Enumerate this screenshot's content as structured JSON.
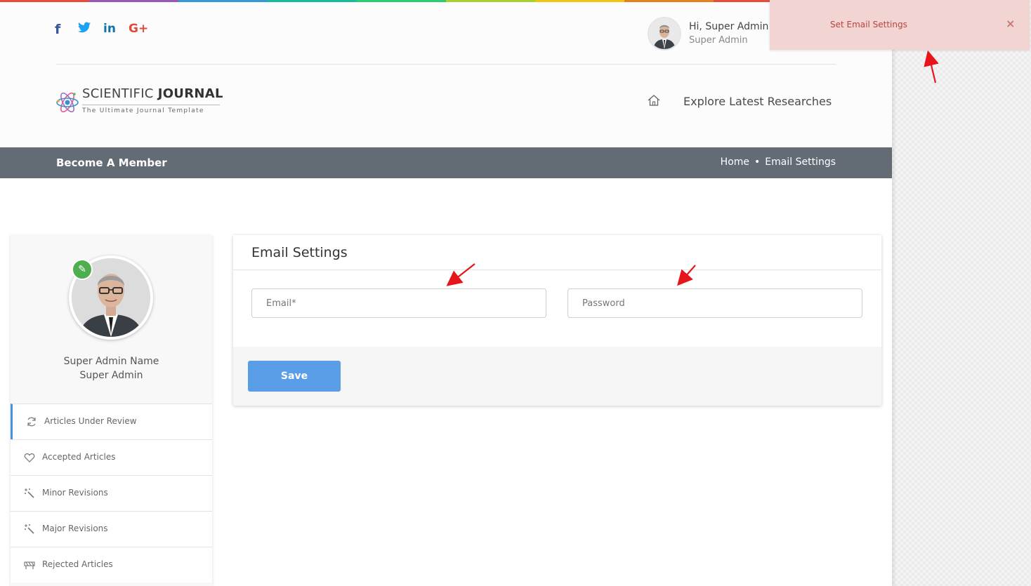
{
  "social": {
    "facebook": "f",
    "twitter": "🐦",
    "linkedin": "in",
    "googleplus": "G+"
  },
  "user": {
    "greeting": "Hi, Super Admin N",
    "role": "Super Admin"
  },
  "logo": {
    "title_light": "SCIENTIFIC ",
    "title_bold": "JOURNAL",
    "tagline": "The Ultimate Journal Template"
  },
  "nav": {
    "explore": "Explore Latest Researches"
  },
  "band": {
    "title": "Become A Member",
    "crumb_home": "Home",
    "crumb_separator": "•",
    "crumb_current": "Email Settings"
  },
  "profile": {
    "name": "Super Admin Name",
    "role": "Super Admin",
    "edit_icon": "pencil-icon"
  },
  "menu": [
    {
      "label": "Articles Under Review",
      "icon": "refresh-icon"
    },
    {
      "label": "Accepted Articles",
      "icon": "heart-icon"
    },
    {
      "label": "Minor Revisions",
      "icon": "magic-wand-icon"
    },
    {
      "label": "Major Revisions",
      "icon": "magic-wand-icon"
    },
    {
      "label": "Rejected Articles",
      "icon": "barrier-icon"
    }
  ],
  "settings": {
    "title": "Email Settings",
    "email_placeholder": "Email*",
    "email_value": "",
    "password_placeholder": "Password",
    "password_value": "",
    "save_label": "Save"
  },
  "toast": {
    "message": "Set Email Settings",
    "close": "×"
  },
  "colors": {
    "band": "#636b75",
    "save_button": "#5b9ee8",
    "toast_bg": "#f2d4d3",
    "toast_text": "#b7443f",
    "active_menu_border": "#4a90e2",
    "annotation_arrow": "#e8141b"
  },
  "rainbow_colors": [
    "#e74c3c",
    "#9b59b6",
    "#3498db",
    "#1abc9c",
    "#2ecc71",
    "#a6d12e",
    "#f1c40f",
    "#e67e22",
    "#e74c3c",
    "#9b59b6"
  ]
}
